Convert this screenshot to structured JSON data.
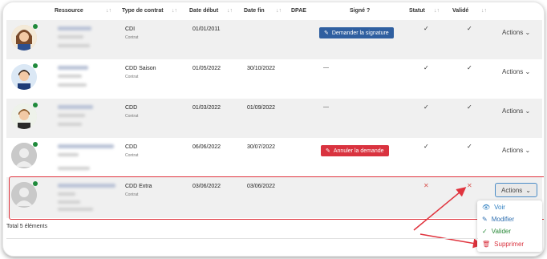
{
  "columns": {
    "ressource": "Ressource",
    "type": "Type de contrat",
    "debut": "Date début",
    "fin": "Date fin",
    "dpae": "DPAE",
    "signe": "Signé ?",
    "statut": "Statut",
    "valide": "Validé",
    "sort_icon": "↓↑"
  },
  "rows": [
    {
      "type": "CDI",
      "sub": "Contrat",
      "debut": "01/01/2011",
      "fin": "",
      "actions": "Actions ⌄",
      "sign_button": "Demander la signature",
      "statut": "✓",
      "valide": "✓"
    },
    {
      "type": "CDD Saison",
      "sub": "Contrat",
      "debut": "01/05/2022",
      "fin": "30/10/2022",
      "actions": "Actions ⌄",
      "sign_mark": "—",
      "statut": "✓",
      "valide": "✓"
    },
    {
      "type": "CDD",
      "sub": "Contrat",
      "debut": "01/03/2022",
      "fin": "01/09/2022",
      "actions": "Actions ⌄",
      "sign_mark": "—",
      "statut": "✓",
      "valide": "✓"
    },
    {
      "type": "CDD",
      "sub": "Contrat",
      "debut": "06/06/2022",
      "fin": "30/07/2022",
      "actions": "Actions ⌄",
      "sign_button": "Annuler la demande",
      "statut": "✓",
      "valide": "✓"
    },
    {
      "type": "CDD Extra",
      "sub": "Contrat",
      "debut": "03/06/2022",
      "fin": "03/06/2022",
      "actions": "Actions",
      "statut": "✕",
      "valide": "✕"
    }
  ],
  "menu": {
    "voir": "Voir",
    "modifier": "Modifier",
    "valider": "Valider",
    "supprimer": "Supprimer"
  },
  "footer": "Total 5 éléments",
  "colors": {
    "accent": "#2f5fa0",
    "danger": "#d9333f",
    "success": "#1f8a3b",
    "highlight": "#e0343e"
  }
}
